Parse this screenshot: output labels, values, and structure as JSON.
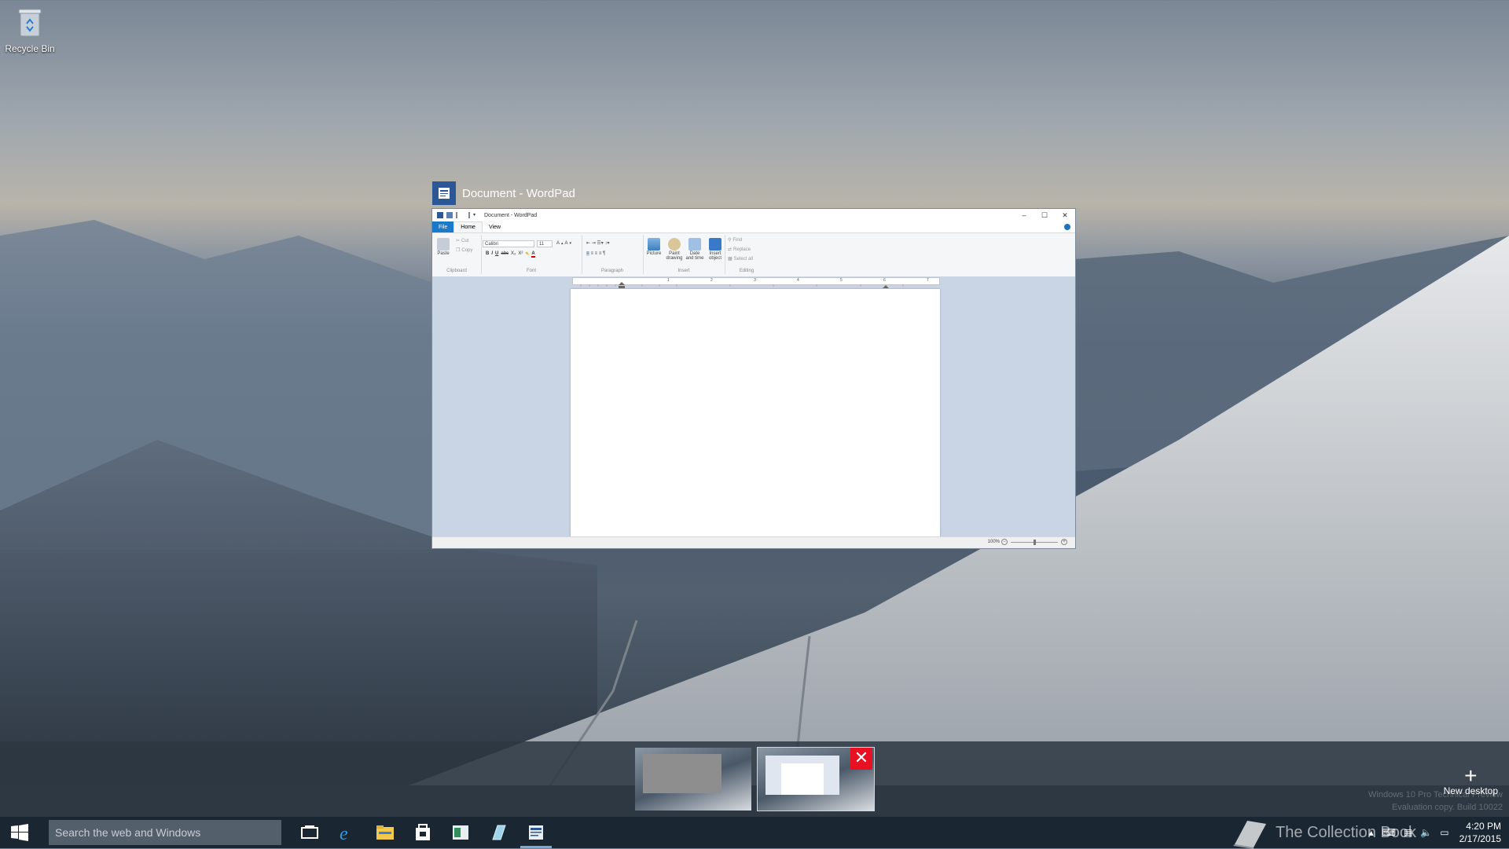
{
  "desktop": {
    "icon_label": "Recycle Bin"
  },
  "task_view": {
    "window_title": "Document - WordPad"
  },
  "wordpad": {
    "titlebar_text": "Document - WordPad",
    "tabs": [
      "File",
      "Home",
      "View"
    ],
    "clipboard": {
      "paste": "Paste",
      "cut": "Cut",
      "copy": "Copy",
      "label": "Clipboard"
    },
    "font": {
      "name": "Calibri",
      "size": "11",
      "label": "Font",
      "buttons": [
        "B",
        "I",
        "U",
        "abc",
        "X₂",
        "X²"
      ]
    },
    "paragraph": {
      "label": "Paragraph"
    },
    "insert": {
      "picture": "Picture",
      "paint": "Paint drawing",
      "datetime": "Date and time",
      "object": "Insert object",
      "label": "Insert"
    },
    "editing": {
      "find": "Find",
      "replace": "Replace",
      "select_all": "Select all",
      "label": "Editing"
    },
    "ruler_marks": [
      "1",
      "2",
      "3",
      "4",
      "5",
      "6",
      "7"
    ],
    "zoom": "100%"
  },
  "desktops_bar": {
    "new_desktop": "New desktop",
    "close_symbol": "✕"
  },
  "watermark": {
    "line1": "Windows 10 Pro Technical Preview",
    "line2": "Evaluation copy. Build 10022"
  },
  "taskbar": {
    "search_placeholder": "Search the web and Windows",
    "brand": "The Collection Book",
    "time": "4:20 PM",
    "date": "2/17/2015"
  },
  "colors": {
    "taskbar": "#1b2633",
    "accent": "#1979ca",
    "close_red": "#e81123"
  }
}
